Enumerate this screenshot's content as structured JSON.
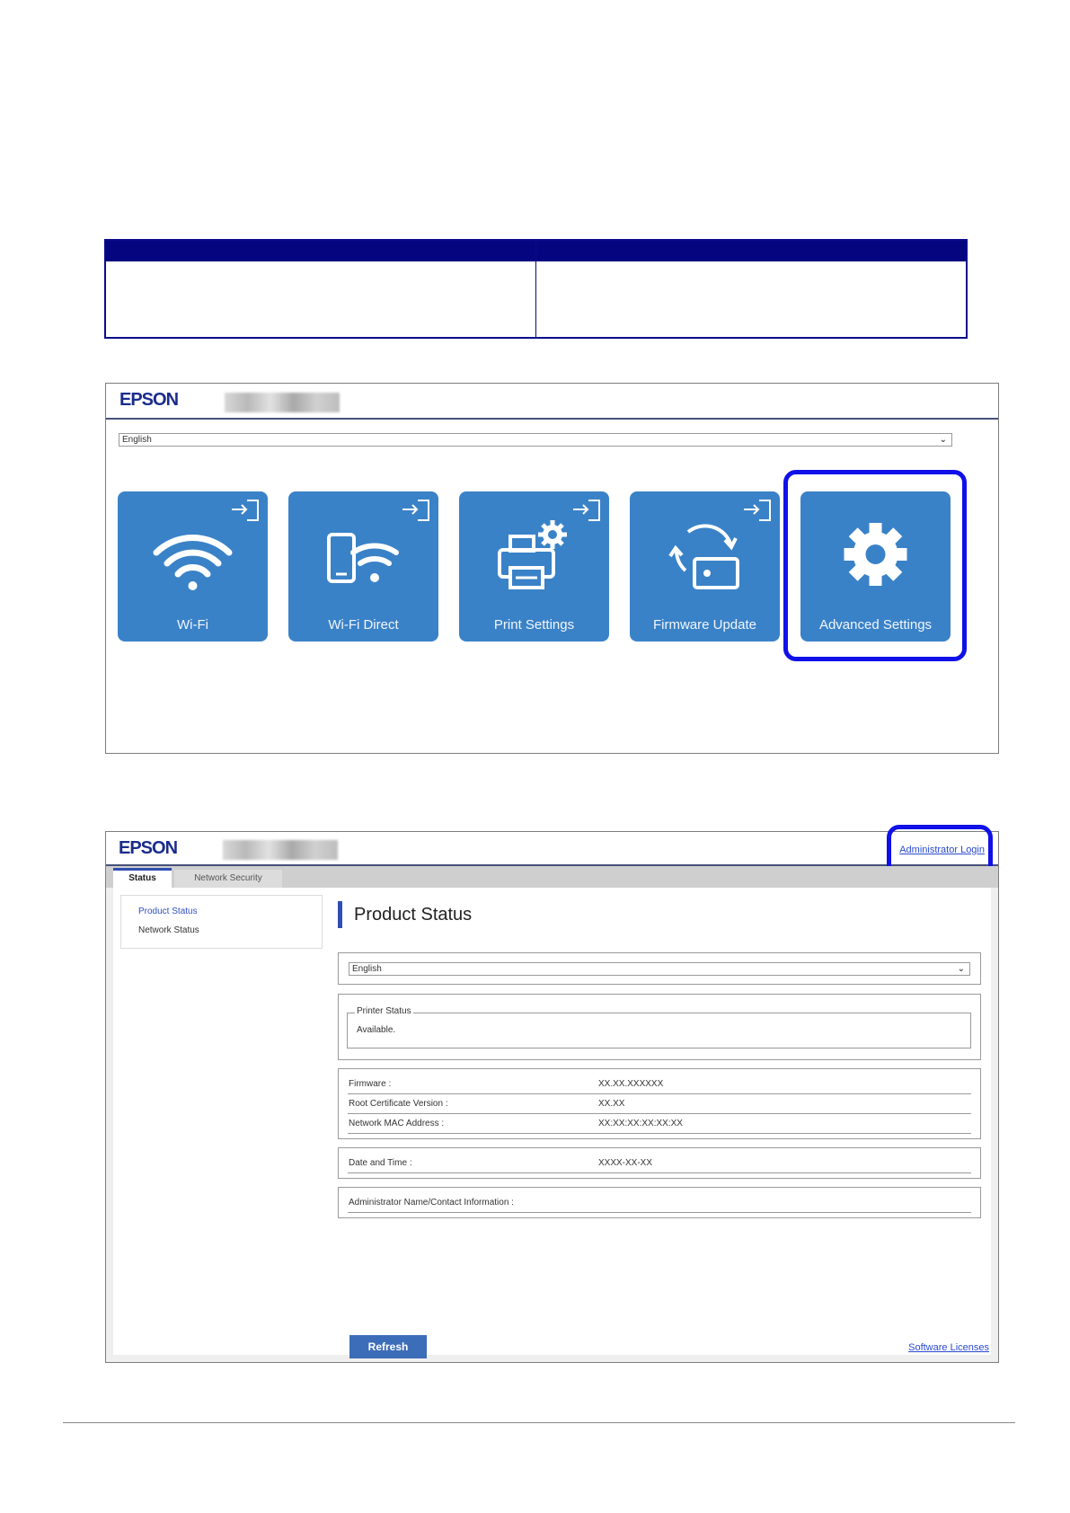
{
  "shot1": {
    "logo": "EPSON",
    "language": "English",
    "tiles": [
      {
        "label": "Wi-Fi",
        "icon": "wifi-icon"
      },
      {
        "label": "Wi-Fi Direct",
        "icon": "wifi-direct-icon"
      },
      {
        "label": "Print Settings",
        "icon": "printer-settings-icon"
      },
      {
        "label": "Firmware Update",
        "icon": "firmware-update-icon"
      },
      {
        "label": "Advanced Settings",
        "icon": "gear-icon"
      }
    ],
    "highlighted_tile": "Advanced Settings",
    "tile_color": "#3a82c8",
    "highlight_color": "#1010e8"
  },
  "shot2": {
    "logo": "EPSON",
    "admin_link": "Administrator Login",
    "tabs": [
      {
        "label": "Status",
        "active": true
      },
      {
        "label": "Network Security",
        "active": false
      }
    ],
    "sidenav": [
      {
        "label": "Product Status",
        "active": true
      },
      {
        "label": "Network Status",
        "active": false
      }
    ],
    "title": "Product Status",
    "language": "English",
    "printer_status": {
      "legend": "Printer Status",
      "value": "Available."
    },
    "info_rows": [
      {
        "key": "Firmware :",
        "value": "XX.XX.XXXXXX"
      },
      {
        "key": "Root Certificate Version :",
        "value": "XX.XX"
      },
      {
        "key": "Network MAC Address :",
        "value": "XX:XX:XX:XX:XX:XX"
      }
    ],
    "date_row": {
      "key": "Date and Time :",
      "value": "XXXX-XX-XX"
    },
    "admin_row": {
      "key": "Administrator Name/Contact Information :"
    },
    "refresh_label": "Refresh",
    "licenses_link": "Software Licenses"
  }
}
